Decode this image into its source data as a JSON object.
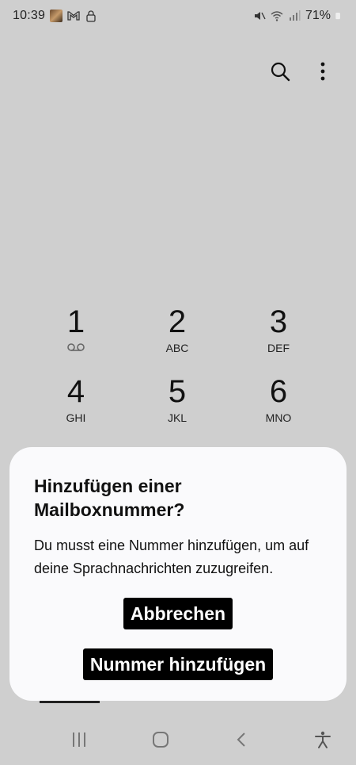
{
  "status_bar": {
    "time": "10:39",
    "battery": "71%",
    "left_icons": [
      "avatar-thumbnail",
      "gmail-icon",
      "lock-icon"
    ],
    "right_icons": [
      "mute-icon",
      "wifi-icon",
      "signal-icon",
      "battery-icon"
    ]
  },
  "toolbar": {
    "icons": [
      "search-icon",
      "more-options-icon"
    ]
  },
  "keypad": {
    "keys": [
      {
        "digit": "1",
        "letters": ""
      },
      {
        "digit": "2",
        "letters": "ABC"
      },
      {
        "digit": "3",
        "letters": "DEF"
      },
      {
        "digit": "4",
        "letters": "GHI"
      },
      {
        "digit": "5",
        "letters": "JKL"
      },
      {
        "digit": "6",
        "letters": "MNO"
      }
    ]
  },
  "dialog": {
    "title": "Hinzufügen einer Mailboxnummer?",
    "body": "Du musst eine Nummer hinzufügen, um auf deine Sprachnachrichten zuzugreifen.",
    "cancel_label": "Abbrechen",
    "confirm_label": "Nummer hinzufügen"
  },
  "navigation_bar": {
    "icons": [
      "recent-apps-icon",
      "home-icon",
      "back-icon",
      "accessibility-icon"
    ]
  },
  "colors": {
    "background": "#cfcfcf",
    "dialog_background": "#fafafc",
    "button_background": "#000000",
    "button_text": "#ffffff"
  }
}
